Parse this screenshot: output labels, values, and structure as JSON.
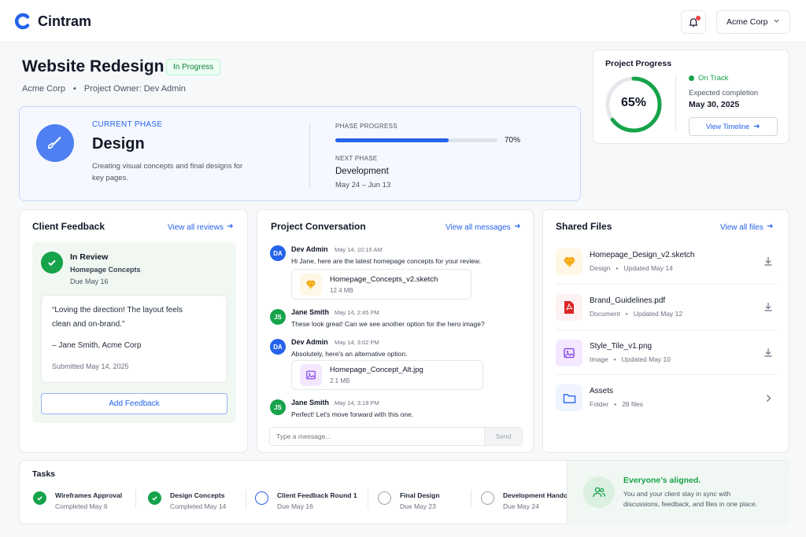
{
  "app": {
    "name": "Cintram",
    "org_selector": "Acme Corp"
  },
  "project": {
    "title": "Website Redesign",
    "status": "In Progress",
    "client": "Acme Corp",
    "owner": "Project Owner: Dev Admin"
  },
  "current_phase": {
    "label": "CURRENT PHASE",
    "name": "Design",
    "description": "Creating visual concepts and final designs for key pages.",
    "progress_label": "PHASE PROGRESS",
    "progress_percent": 70,
    "progress_text": "70%",
    "next_label": "NEXT PHASE",
    "next_name": "Development",
    "next_dates": "May 24 – Jun 13"
  },
  "project_progress": {
    "title": "Project Progress",
    "percent": 65,
    "percent_text": "65%",
    "status": "On Track",
    "expected_label": "Expected completion",
    "expected_date": "May 30, 2025",
    "timeline_button": "View Timeline"
  },
  "client_feedback": {
    "title": "Client Feedback",
    "view_all": "View all reviews",
    "review_status": "In Review",
    "review_item": "Homepage Concepts",
    "review_due": "Due May 16",
    "quote_line1": "“Loving the direction! The layout feels",
    "quote_line2": "clean and on-brand.”",
    "quote_author": "– Jane Smith, Acme Corp",
    "submitted": "Submitted May 14, 2025",
    "add_button": "Add Feedback"
  },
  "conversation": {
    "title": "Project Conversation",
    "view_all": "View all messages",
    "messages": [
      {
        "initials": "DA",
        "author": "Dev Admin",
        "time": "May 14, 10:15 AM",
        "text": "Hi Jane, here are the latest homepage concepts for your review.",
        "attachment": {
          "name": "Homepage_Concepts_v2.sketch",
          "size": "12.4 MB"
        }
      },
      {
        "initials": "JS",
        "author": "Jane Smith",
        "time": "May 14, 2:45 PM",
        "text": "These look great! Can we see another option for the hero image?"
      },
      {
        "initials": "DA",
        "author": "Dev Admin",
        "time": "May 14, 3:02 PM",
        "text": "Absolutely, here's an alternative option.",
        "attachment": {
          "name": "Homepage_Concept_Alt.jpg",
          "size": "2.1 MB"
        }
      },
      {
        "initials": "JS",
        "author": "Jane Smith",
        "time": "May 14, 3:18 PM",
        "text": "Perfect! Let's move forward with this one."
      }
    ],
    "input_placeholder": "Type a message...",
    "send": "Send"
  },
  "shared_files": {
    "title": "Shared Files",
    "view_all": "View all files",
    "files": [
      {
        "name": "Homepage_Design_v2.sketch",
        "type": "Design",
        "updated": "Updated May 14",
        "icon": "sketch-icon"
      },
      {
        "name": "Brand_Guidelines.pdf",
        "type": "Document",
        "updated": "Updated May 12",
        "icon": "pdf-icon"
      },
      {
        "name": "Style_Tile_v1.png",
        "type": "Image",
        "updated": "Updated May 10",
        "icon": "image-icon"
      },
      {
        "name": "Assets",
        "type": "Folder",
        "updated": "28 files",
        "icon": "folder-icon"
      }
    ]
  },
  "tasks": {
    "title": "Tasks",
    "items": [
      {
        "name": "Wireframes Approval",
        "sub": "Completed May 6",
        "state": "done"
      },
      {
        "name": "Design Concepts",
        "sub": "Completed May 14",
        "state": "done"
      },
      {
        "name": "Client Feedback Round 1",
        "sub": "Due May 16",
        "state": "active"
      },
      {
        "name": "Final Design",
        "sub": "Due May 23",
        "state": "todo"
      },
      {
        "name": "Development Handoff",
        "sub": "Due May 24",
        "state": "todo"
      }
    ]
  },
  "aligned": {
    "title": "Everyone's aligned.",
    "text_line1": "You and your client stay in sync with",
    "text_line2": "discussions, feedback, and files in one place."
  },
  "colors": {
    "primary": "#2563eb",
    "success": "#16a34a",
    "warning": "#f59e0b",
    "pdf": "#dc2626",
    "image": "#7c3aed"
  }
}
